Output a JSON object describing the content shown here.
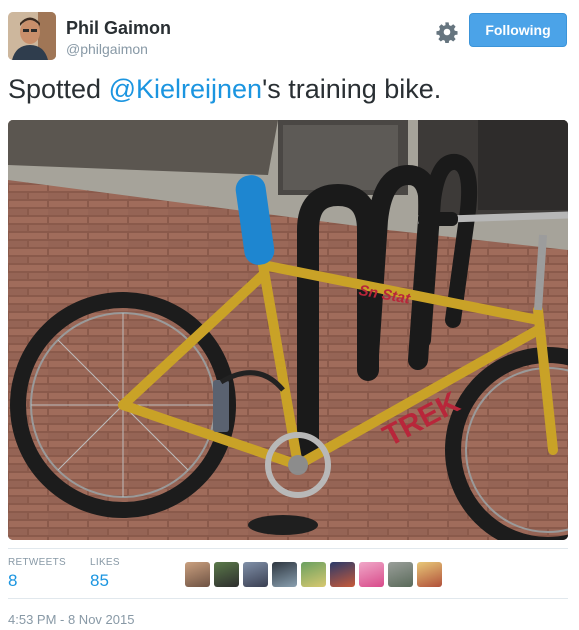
{
  "user": {
    "display_name": "Phil Gaimon",
    "username": "@philgaimon",
    "avatar_icon": "profile-photo"
  },
  "actions": {
    "settings_icon": "gear-icon",
    "follow_label": "Following",
    "follow_color": "#4ba3e8"
  },
  "tweet": {
    "text_before": "Spotted ",
    "mention": "@Kielreijnen",
    "text_after": "'s training bike.",
    "mention_color": "#1b95e0"
  },
  "media": {
    "description_icon": "photo-bike-icon",
    "frame_text": "TREK",
    "top_tube_text": "Sn Stat"
  },
  "stats": {
    "retweets_label": "RETWEETS",
    "retweets_value": "8",
    "likes_label": "LIKES",
    "likes_value": "85",
    "liker_avatars": [
      "liker-1",
      "liker-2",
      "liker-3",
      "liker-4",
      "liker-5",
      "liker-6",
      "liker-7",
      "liker-8",
      "liker-9"
    ]
  },
  "timestamp": "4:53 PM - 8 Nov 2015"
}
